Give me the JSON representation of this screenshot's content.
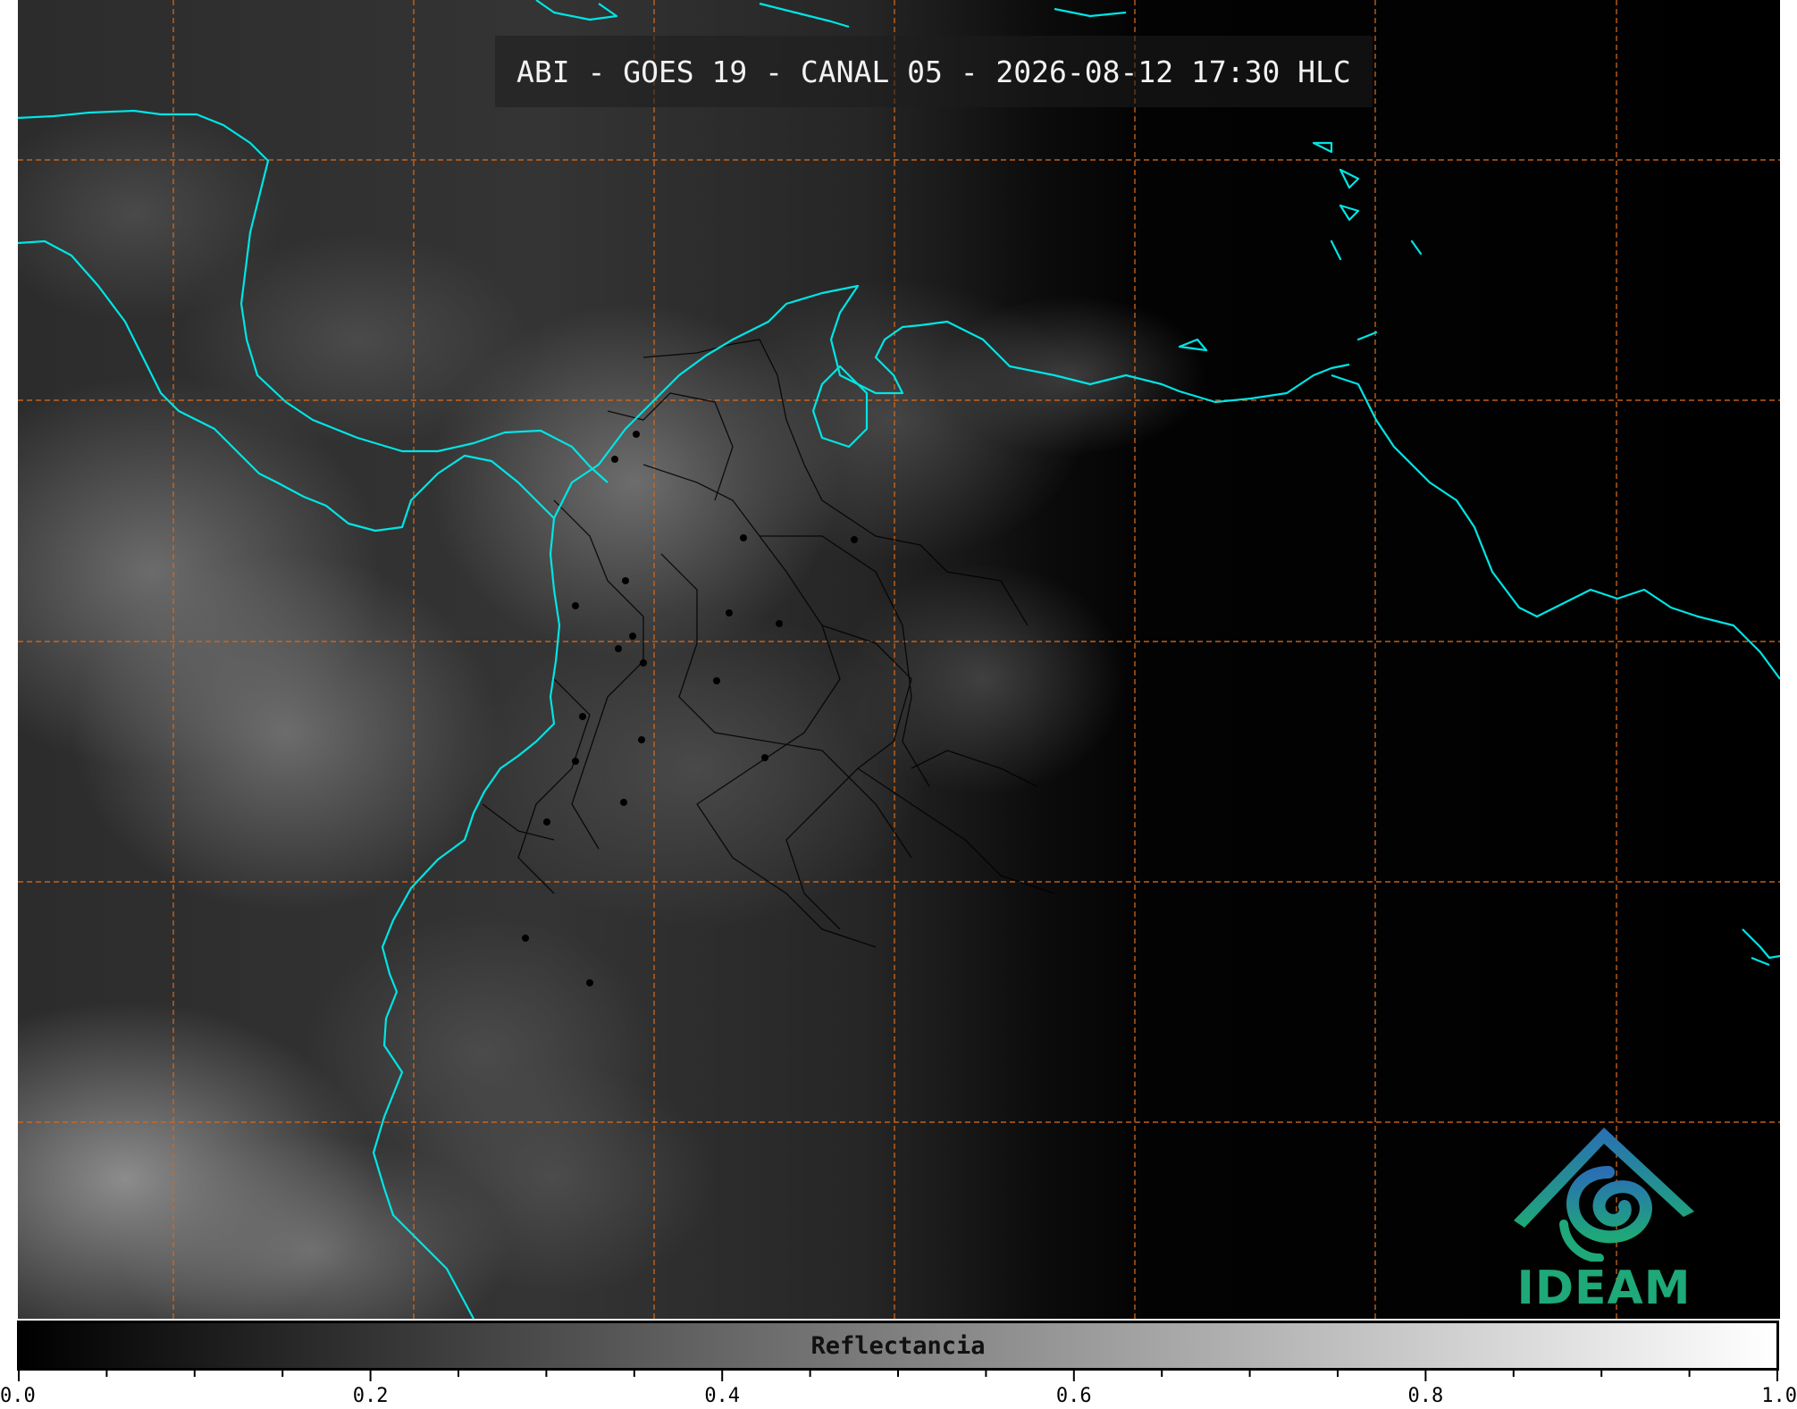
{
  "title": "ABI - GOES 19 - CANAL 05 - 2026-08-12 17:30 HLC",
  "logo": {
    "text": "IDEAM",
    "icon": "ideam-logo-icon"
  },
  "colorbar": {
    "label": "Reflectancia",
    "min": 0.0,
    "max": 1.0,
    "ticks": [
      "0.0",
      "0.2",
      "0.4",
      "0.6",
      "0.8",
      "1.0"
    ],
    "colors": {
      "low": "#000000",
      "high": "#ffffff"
    }
  },
  "map": {
    "coastline_color": "#00e5e5",
    "graticule_color": "#d2691e",
    "border_color": "#000000",
    "background": "#000000"
  }
}
